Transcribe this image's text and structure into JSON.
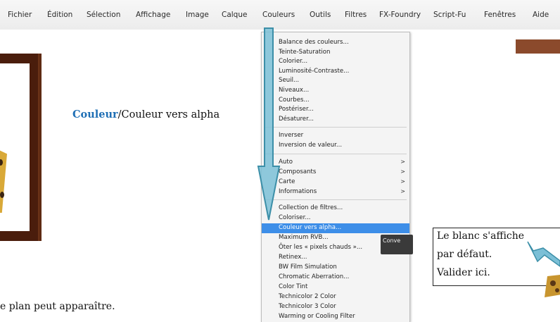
{
  "menubar": {
    "items": [
      "Fichier",
      "Édition",
      "Sélection",
      "Affichage",
      "Image",
      "Calque",
      "Couleurs",
      "Outils",
      "Filtres",
      "FX-Foundry",
      "Script-Fu",
      "Fenêtres",
      "Aide"
    ]
  },
  "tutorial": {
    "instruction_highlight": "Couleur",
    "instruction_rest": "/Couleur vers alpha",
    "bottom_text": "e plan peut apparaître."
  },
  "couleurs_menu": {
    "group1": [
      "Balance des couleurs...",
      "Teinte-Saturation",
      "Colorier...",
      "Luminosité-Contraste...",
      "Seuil...",
      "Niveaux...",
      "Courbes...",
      "Postériser...",
      "Désaturer..."
    ],
    "group2": [
      "Inverser",
      "Inversion de valeur..."
    ],
    "group3": [
      "Auto",
      "Composants",
      "Carte",
      "Informations"
    ],
    "group4": [
      "Collection de filtres...",
      "Coloriser...",
      "Couleur vers alpha...",
      "Maximum RVB...",
      "Ôter les « pixels chauds »...",
      "Retinex...",
      "BW Film Simulation",
      "Chromatic Aberration...",
      "Color Tint",
      "Technicolor 2 Color",
      "Technicolor 3 Color",
      "Warming or Cooling Filter"
    ],
    "active_item": "Couleur vers alpha...",
    "submenu_arrow": ">"
  },
  "tooltip": {
    "text": "Conve"
  },
  "note": {
    "lines": [
      "Le blanc s'affiche",
      "par défaut.",
      "Valider ici."
    ]
  },
  "colors": {
    "highlight_blue": "#3d8ee8",
    "arrow_fill": "#7bbfd6",
    "frame_brown": "#4a1d0c"
  }
}
